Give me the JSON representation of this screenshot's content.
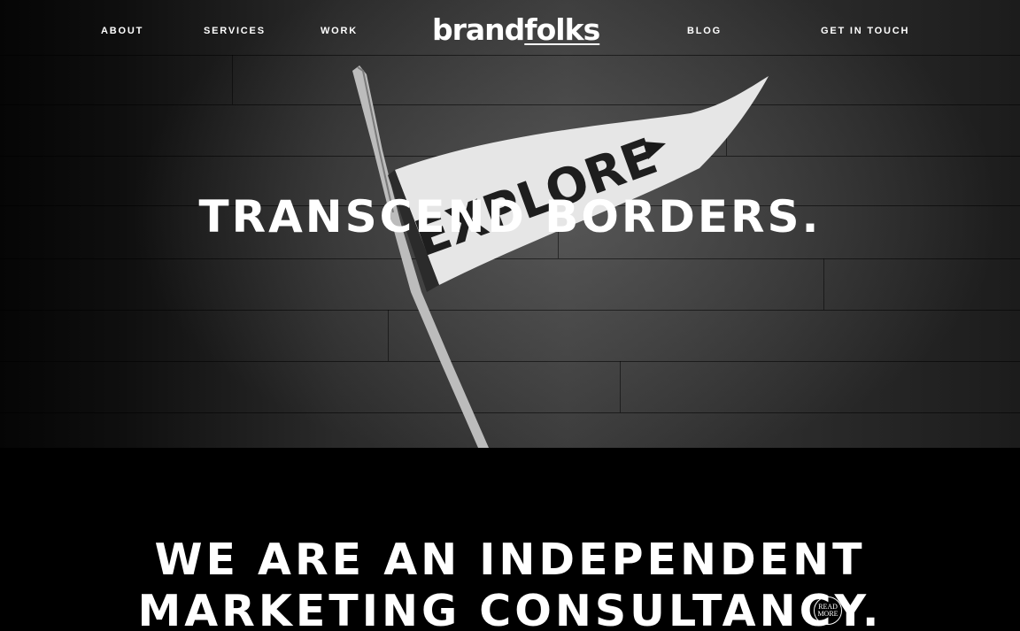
{
  "nav": {
    "left": [
      {
        "label": "ABOUT"
      },
      {
        "label": "SERVICES"
      },
      {
        "label": "WORK"
      }
    ],
    "logo": {
      "part1": "brand",
      "part2": "folks"
    },
    "right": [
      {
        "label": "BLOG"
      },
      {
        "label": "GET IN TOUCH"
      }
    ]
  },
  "hero": {
    "headline": "TRANSCEND BORDERS.",
    "pennant_text": "EXPLORE"
  },
  "about": {
    "line1": "WE ARE AN INDEPENDENT",
    "line2": "MARKETING CONSULTANCY.",
    "read_more_line1": "READ",
    "read_more_line2": "MORE"
  }
}
